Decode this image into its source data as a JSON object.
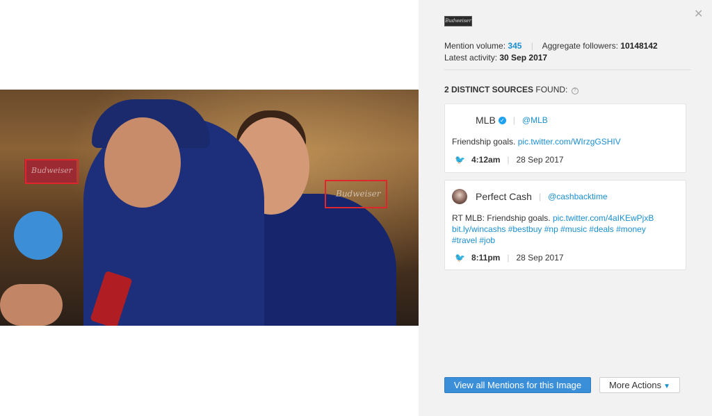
{
  "brand": {
    "logo_text": "Budweiser"
  },
  "stats": {
    "mention_label": "Mention volume:",
    "mention_value": "345",
    "followers_label": "Aggregate followers:",
    "followers_value": "10148142",
    "latest_label": "Latest activity:",
    "latest_value": "30 Sep 2017"
  },
  "sources": {
    "count_text": "2 DISTINCT SOURCES",
    "found_text": "FOUND:"
  },
  "mentions": [
    {
      "name": "MLB",
      "handle": "@MLB",
      "text_prefix": "Friendship goals.",
      "link1": "pic.twitter.com/WIrzgGSHIV",
      "time": "4:12am",
      "date": "28 Sep 2017"
    },
    {
      "name": "Perfect Cash",
      "handle": "@cashbacktime",
      "text_prefix": "RT MLB: Friendship goals.",
      "link1": "pic.twitter.com/4aIKEwPjxB",
      "line2": "bit.ly/wincashs #bestbuy #np #music #deals #money",
      "line3": "#travel #job",
      "time": "8:11pm",
      "date": "28 Sep 2017"
    }
  ],
  "actions": {
    "view_all": "View all Mentions for this Image",
    "more": "More Actions"
  },
  "icons": {
    "close": "close-icon",
    "info": "info-icon",
    "twitter": "twitter-bird-icon",
    "verified": "verified-icon",
    "chevron": "chevron-down-icon"
  },
  "colors": {
    "accent": "#1a8fd0",
    "button": "#3b8fd9",
    "detection_box": "#e0262d"
  }
}
